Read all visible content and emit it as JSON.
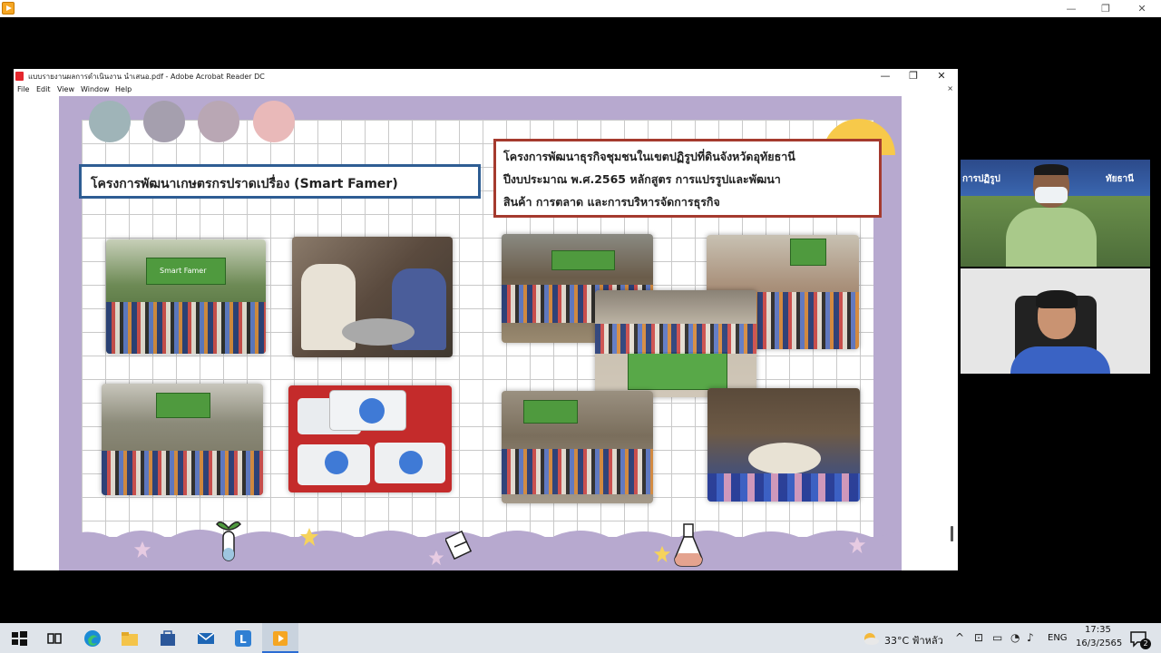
{
  "outer_window": {
    "minimize_glyph": "—",
    "maximize_glyph": "❐",
    "close_glyph": "✕"
  },
  "acrobat": {
    "title": "แบบรายงานผลการดำเนินงาน นำเสนอ.pdf - Adobe Acrobat Reader DC",
    "menu": [
      "File",
      "Edit",
      "View",
      "Window",
      "Help"
    ],
    "minimize_glyph": "—",
    "restore_glyph": "❐",
    "close_glyph": "✕",
    "doc_close_glyph": "×"
  },
  "slide": {
    "title_left": "โครงการพัฒนาเกษตรกรปราดเปรื่อง (Smart Famer)",
    "title_right_lines": [
      "โครงการพัฒนาธุรกิจชุมชนในเขตปฏิรูปที่ดินจังหวัดอุทัยธานี",
      "ปีงบประมาณ พ.ศ.2565 หลักสูตร การแปรรูปและพัฒนา",
      "สินค้า การตลาด และการบริหารจัดการธุรกิจ"
    ],
    "banner_text": "Smart Famer",
    "swatch_colors": [
      "#9fb4b8",
      "#a59fae",
      "#b9a7b4",
      "#e9b9b9"
    ]
  },
  "video": {
    "top_overlay_text": "การปฏิรูป",
    "top_overlay_text_right": "ทัยธานี"
  },
  "taskbar": {
    "weather": "33°C ฟ้าหลัว",
    "language": "ENG",
    "time": "17:35",
    "date": "16/3/2565",
    "notification_count": "2"
  }
}
